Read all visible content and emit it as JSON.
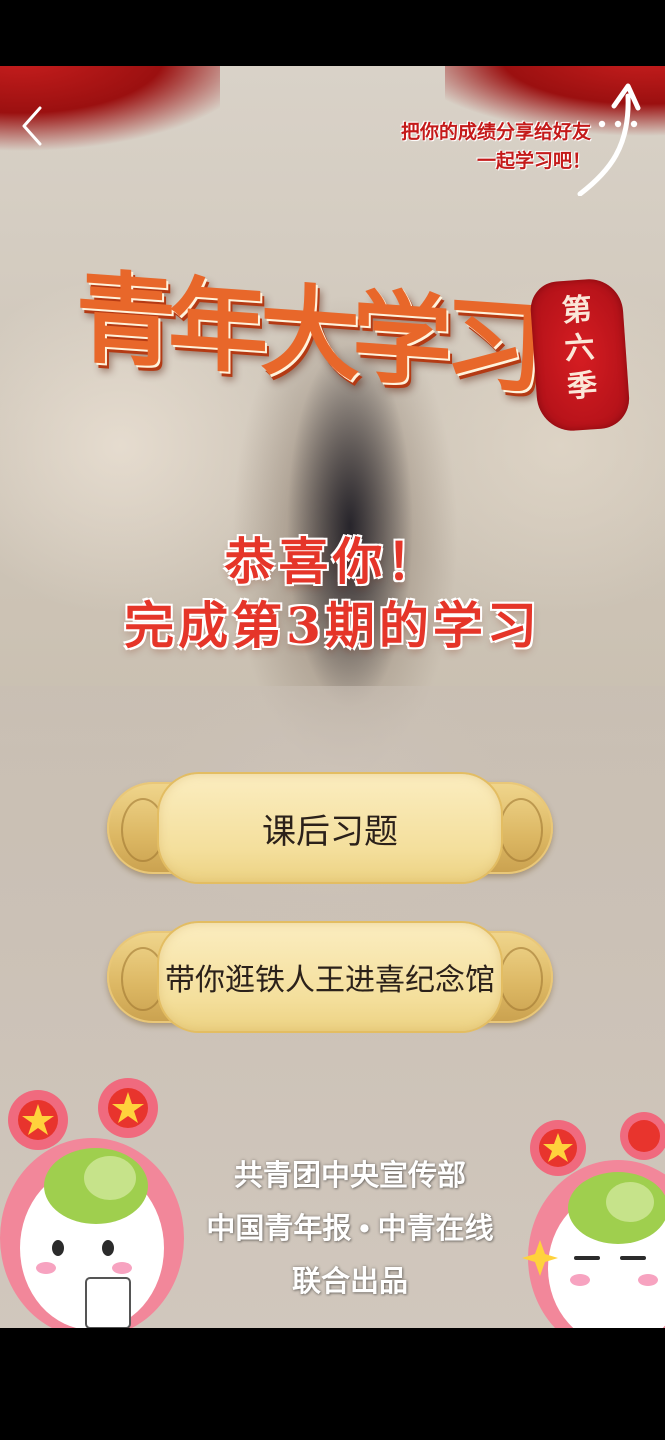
{
  "nav": {
    "back_icon": "chevron-left-icon",
    "more_icon": "more-dots-icon"
  },
  "share": {
    "line1": "把你的成绩分享给好友",
    "line2": "一起学习吧！"
  },
  "logo": {
    "title": "青年大学习",
    "seal_text": "第六季"
  },
  "congrats": {
    "line1": "恭喜你！",
    "line2": "完成第3期的学习"
  },
  "buttons": {
    "exercise_label": "课后习题",
    "museum_label": "带你逛铁人王进喜纪念馆"
  },
  "credits": {
    "line1": "共青团中央宣传部",
    "line2": "中国青年报 • 中青在线",
    "line3": "联合出品"
  },
  "colors": {
    "accent_red": "#c41a1a",
    "title_orange": "#e8672a",
    "scroll_gold": "#f4df9c"
  }
}
